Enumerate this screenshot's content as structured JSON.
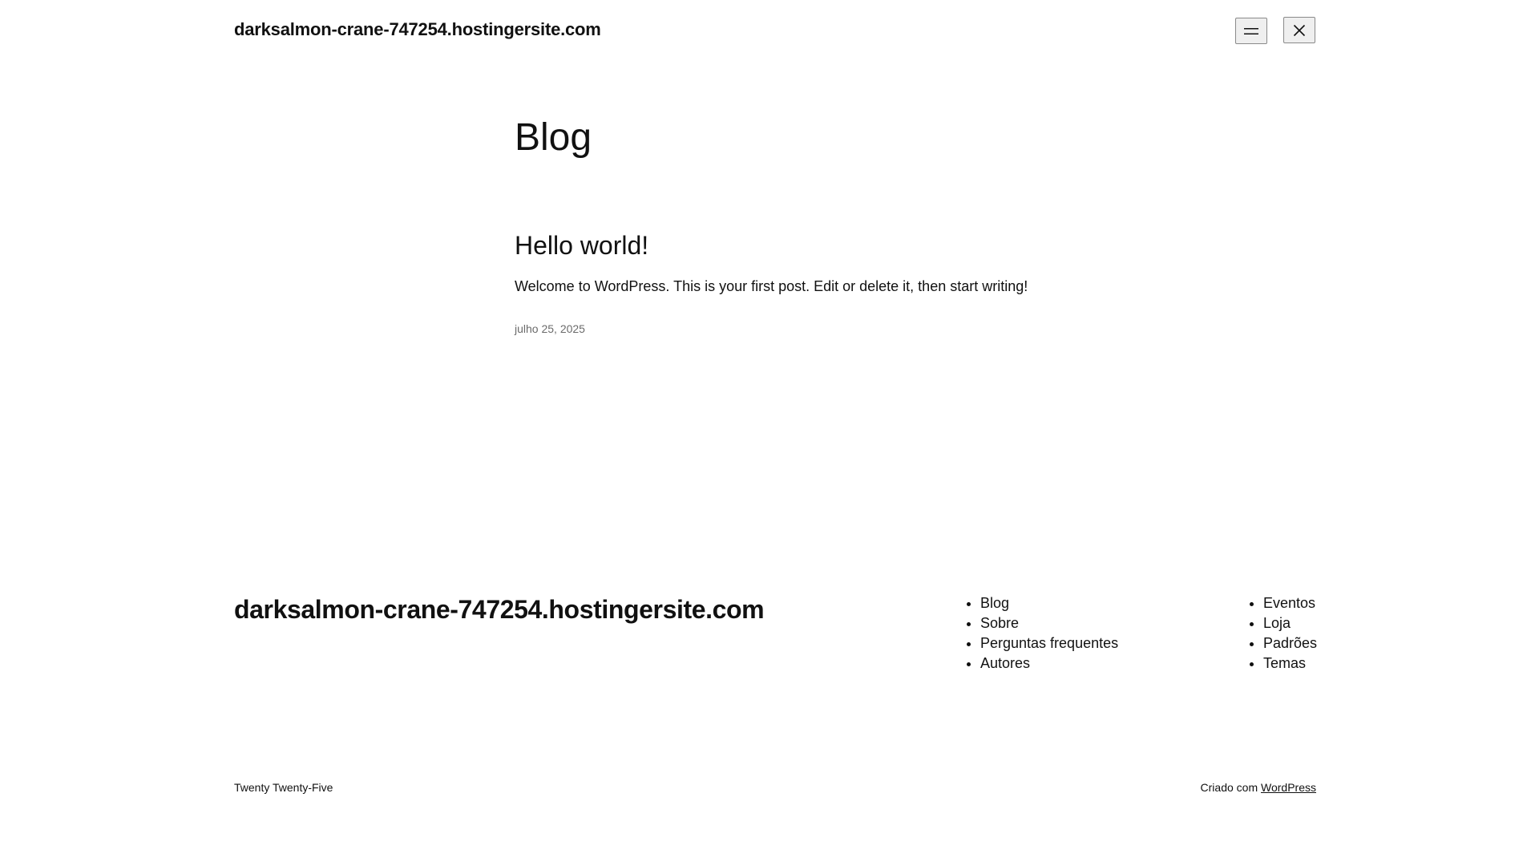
{
  "header": {
    "site_title": "darksalmon-crane-747254.hostingersite.com",
    "menu_icon": "hamburger-menu-icon",
    "close_icon": "close-icon"
  },
  "main": {
    "heading": "Blog",
    "posts": [
      {
        "title": "Hello world!",
        "excerpt": "Welcome to WordPress. This is your first post. Edit or delete it, then start writing!",
        "date": "julho 25, 2025"
      }
    ]
  },
  "footer": {
    "site_title": "darksalmon-crane-747254.hostingersite.com",
    "nav_column_1": [
      "Blog",
      "Sobre",
      "Perguntas frequentes",
      "Autores"
    ],
    "nav_column_2": [
      "Eventos",
      "Loja",
      "Padrões",
      "Temas"
    ],
    "theme_name": "Twenty Twenty-Five",
    "credit_prefix": "Criado com",
    "credit_link": "WordPress"
  },
  "colors": {
    "text": "#111111",
    "muted": "#6b6b6b",
    "background": "#ffffff"
  }
}
